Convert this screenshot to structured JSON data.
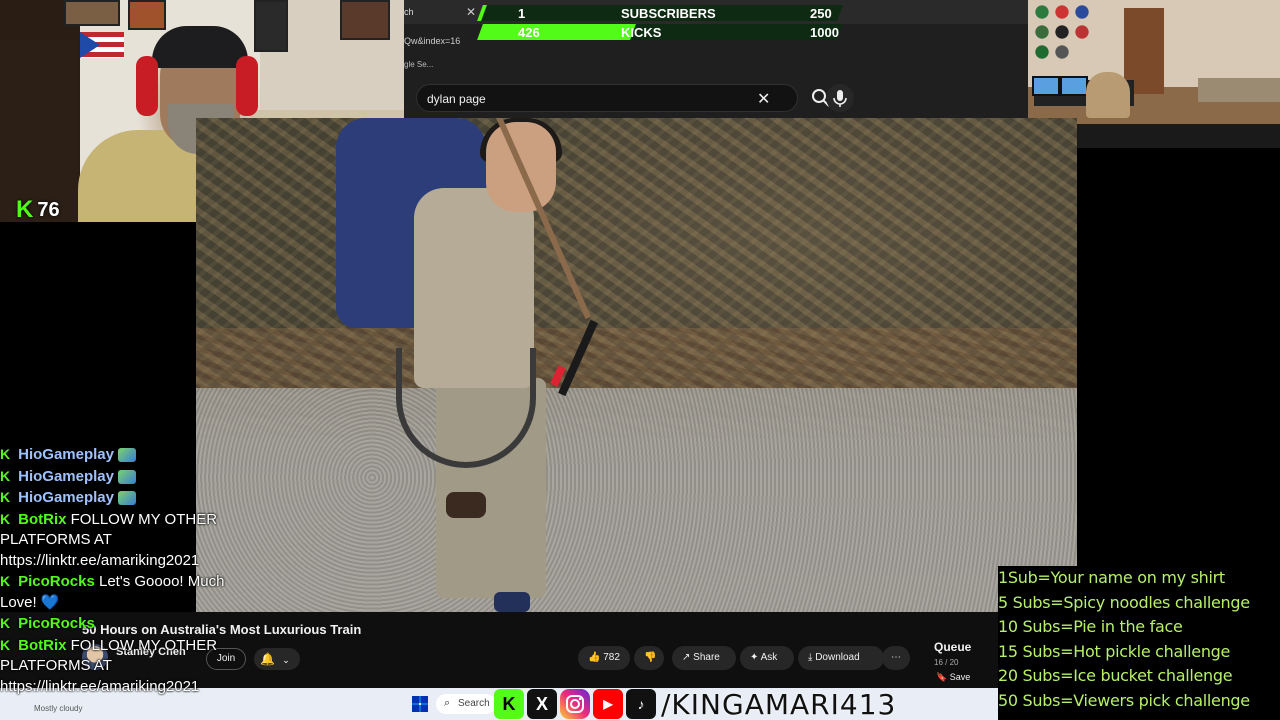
{
  "webcam": {
    "kick_viewer_count": "76"
  },
  "goals": {
    "subscribers": {
      "current": "1",
      "label": "SUBSCRIBERS",
      "target": "250",
      "progress": 0.004
    },
    "kicks": {
      "current": "426",
      "label": "KICKS",
      "target": "1000",
      "progress": 0.426
    }
  },
  "browser": {
    "tab_fragment": "ch",
    "url_fragment": "Qw&index=16",
    "bookmark_fragment": "gle Se...",
    "search_query": "dylan page"
  },
  "chat": {
    "messages": [
      {
        "user": "HioGameplay",
        "text": ""
      },
      {
        "user": "HioGameplay",
        "text": ""
      },
      {
        "user": "HioGameplay",
        "text": ""
      },
      {
        "user": "BotRix",
        "text": "FOLLOW MY OTHER PLATFORMS AT https://linktr.ee/amariking2021"
      },
      {
        "user": "PicoRocks",
        "text": "Let's Goooo! Much Love!"
      },
      {
        "user": "PicoRocks",
        "text": ""
      },
      {
        "user": "BotRix",
        "text": "FOLLOW MY OTHER PLATFORMS AT https://linktr.ee/amariking2021"
      }
    ]
  },
  "youtube": {
    "video_title": "50 Hours on Australia's Most Luxurious Train",
    "channel_name": "Stanley Chen",
    "channel_subs": "",
    "join_label": "Join",
    "like_count": "782",
    "share_label": "Share",
    "ask_label": "Ask",
    "download_label": "Download",
    "queue_title": "Queue",
    "queue_count": "16 / 20",
    "save_label": "Save"
  },
  "sub_goals": [
    "1Sub=Your name on my shirt",
    "5 Subs=Spicy noodles challenge",
    "10 Subs=Pie in the face",
    "15 Subs=Hot pickle challenge",
    "20 Subs=Ice bucket challenge",
    "50 Subs=Viewers pick challenge"
  ],
  "taskbar": {
    "weather": "Mostly cloudy",
    "search_label": "Search"
  },
  "socials": {
    "handle": "/KINGAMARI413",
    "kick": "K",
    "x": "X",
    "youtube": "▶",
    "tiktok": "♪"
  },
  "colors": {
    "kick_green": "#53fc18",
    "goal_text": "#b6f06a",
    "yt_bg": "#0f0f0f"
  }
}
